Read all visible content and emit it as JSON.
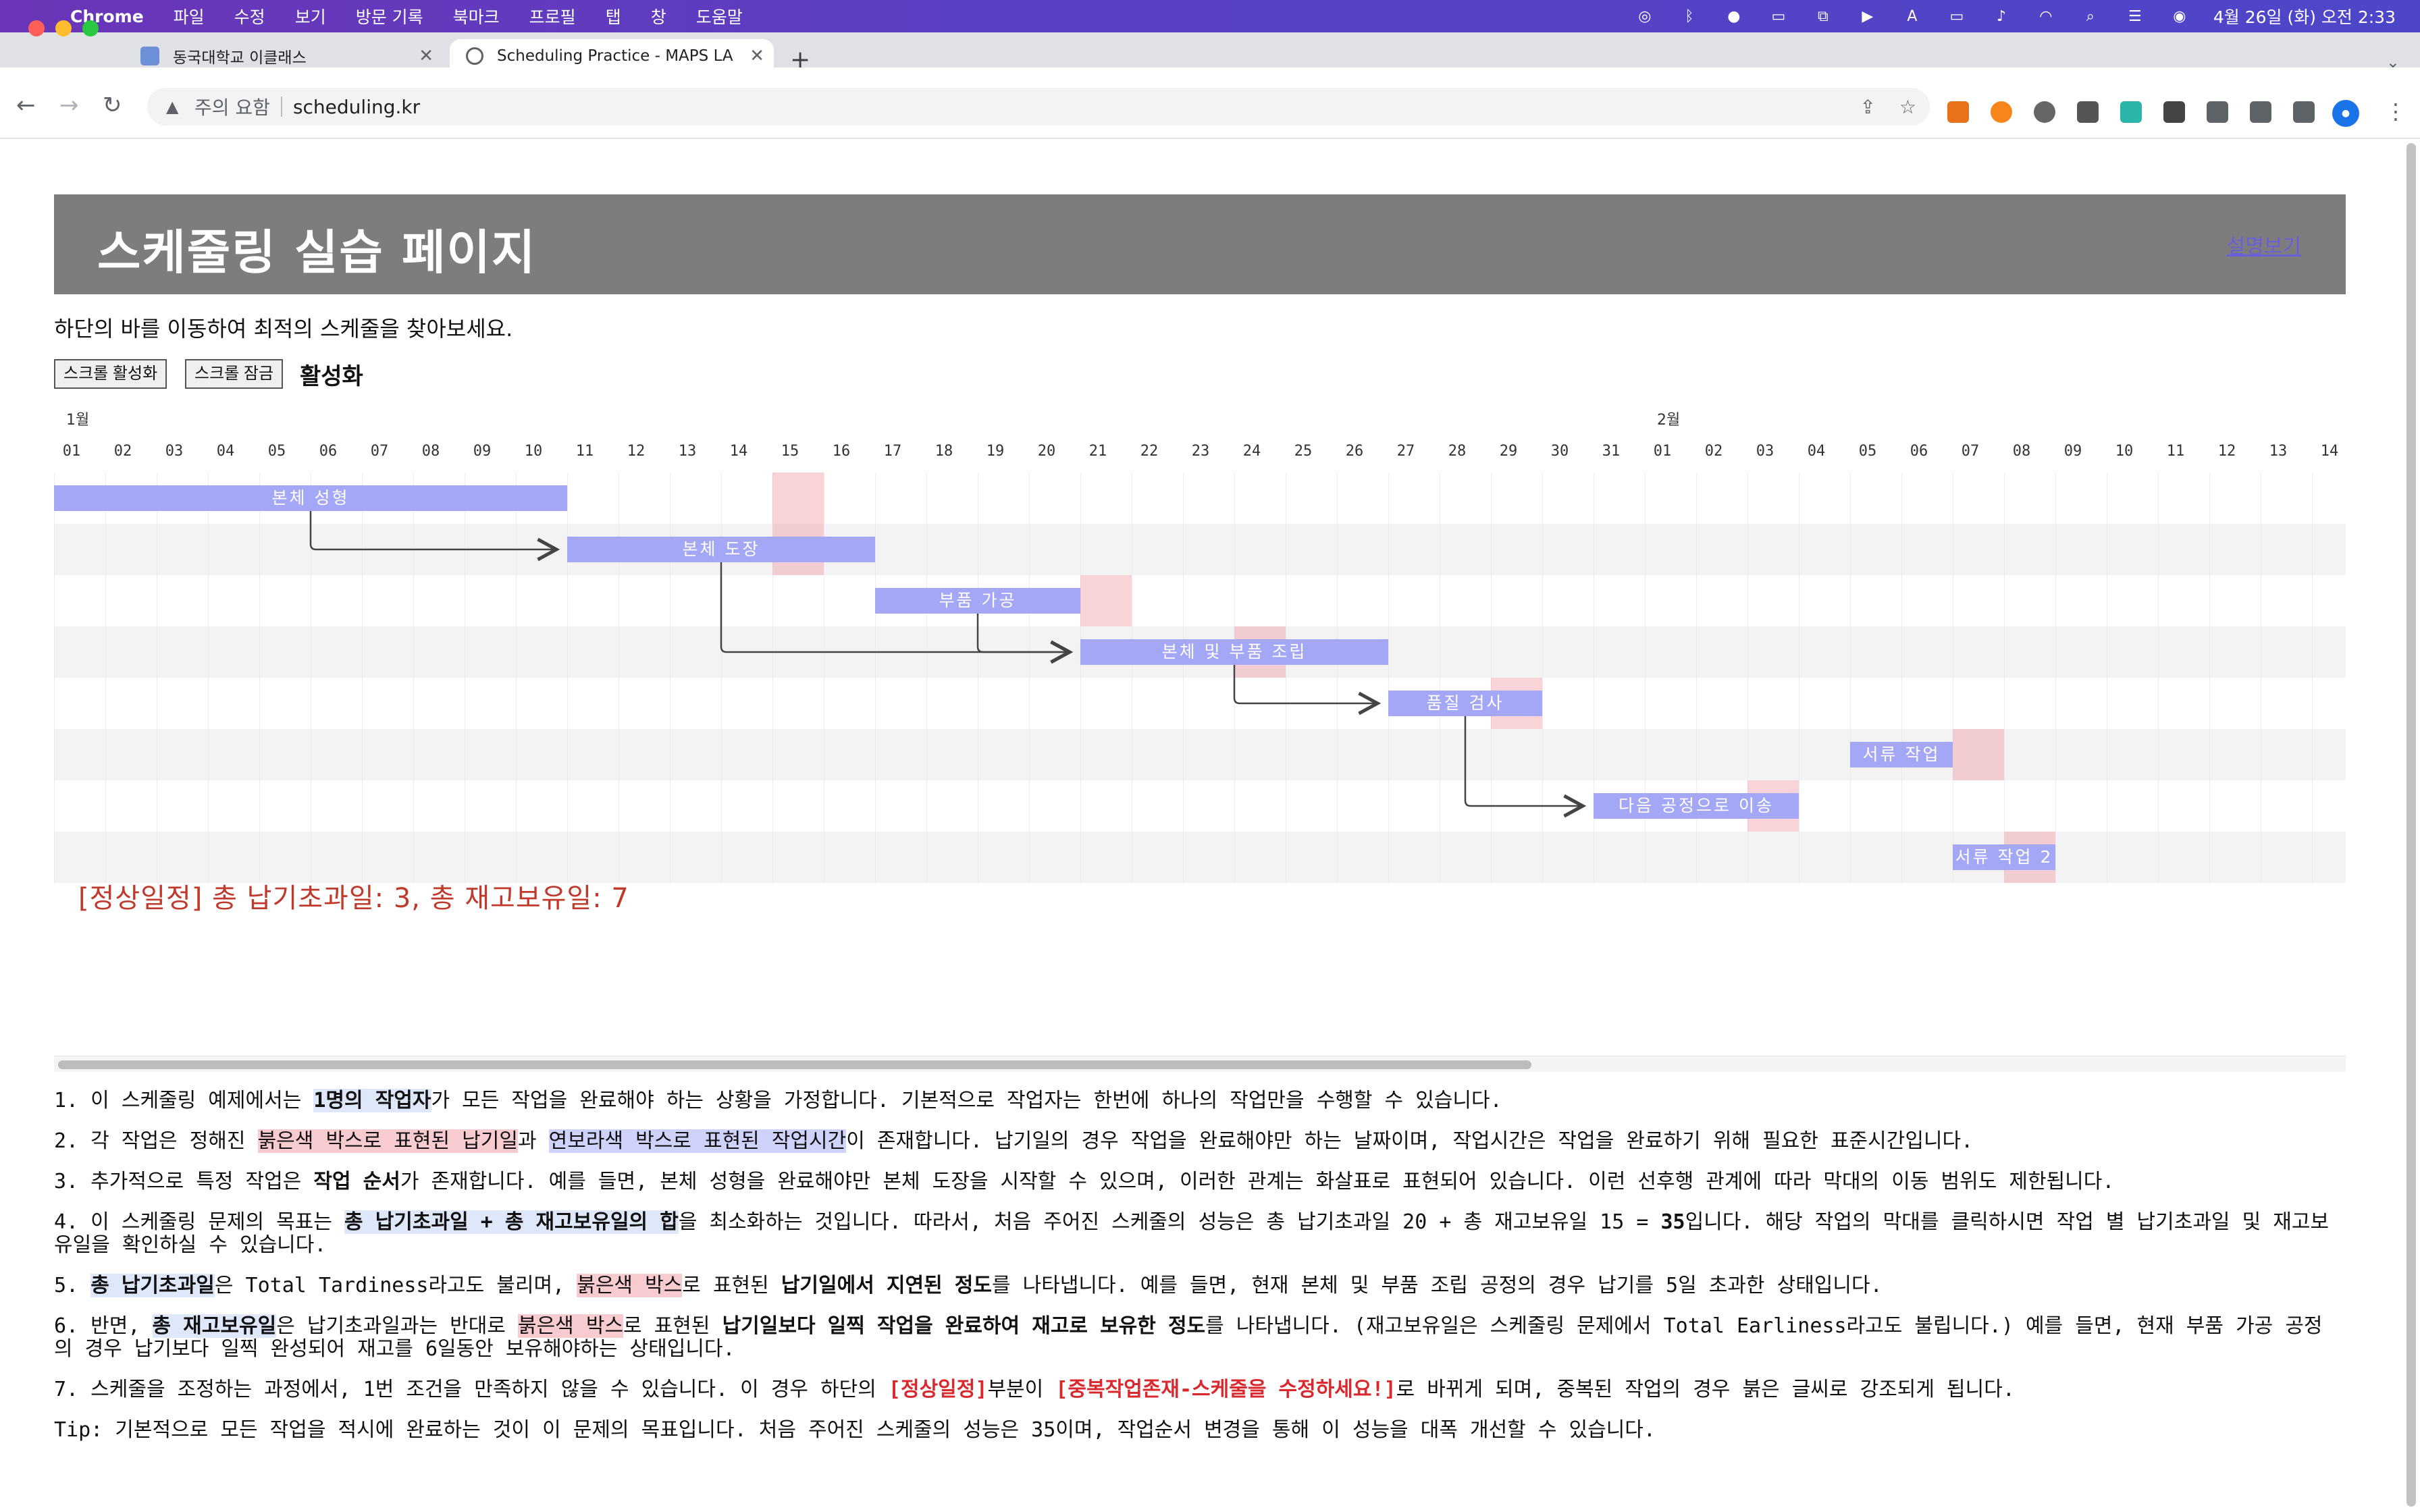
{
  "menubar": {
    "app": "Chrome",
    "items": [
      "파일",
      "수정",
      "보기",
      "방문 기록",
      "북마크",
      "프로필",
      "탭",
      "창",
      "도움말"
    ],
    "clock": "4월 26일 (화) 오전 2:33"
  },
  "tabs": [
    {
      "title": "동국대학교 이클래스"
    },
    {
      "title": "Scheduling Practice - MAPS LA"
    }
  ],
  "omnibox": {
    "warning": "주의 요함",
    "url": "scheduling.kr"
  },
  "page": {
    "title": "스케줄링 실습 페이지",
    "help_link": "설명보기",
    "subtitle": "하단의 바를 이동하여 최적의 스케줄을 찾아보세요.",
    "btn_scroll_on": "스크롤 활성화",
    "btn_scroll_lock": "스크롤 잠금",
    "status": "활성화",
    "summary": "[정상일정] 총 납기초과일: 3, 총 재고보유일: 7"
  },
  "gantt": {
    "months": [
      {
        "label": "1월",
        "col": 0
      },
      {
        "label": "2월",
        "col": 31
      }
    ],
    "days": [
      "01",
      "02",
      "03",
      "04",
      "05",
      "06",
      "07",
      "08",
      "09",
      "10",
      "11",
      "12",
      "13",
      "14",
      "15",
      "16",
      "17",
      "18",
      "19",
      "20",
      "21",
      "22",
      "23",
      "24",
      "25",
      "26",
      "27",
      "28",
      "29",
      "30",
      "31",
      "01",
      "02",
      "03",
      "04",
      "05",
      "06",
      "07",
      "08",
      "09",
      "10",
      "11",
      "12",
      "13",
      "14"
    ],
    "tasks": [
      {
        "name": "본체 성형",
        "start": 0,
        "dur": 10,
        "due": 14
      },
      {
        "name": "본체 도장",
        "start": 10,
        "dur": 6,
        "due": 14
      },
      {
        "name": "부품 가공",
        "start": 16,
        "dur": 4,
        "due": 20
      },
      {
        "name": "본체 및 부품 조립",
        "start": 20,
        "dur": 6,
        "due": 23
      },
      {
        "name": "품질 검사",
        "start": 26,
        "dur": 3,
        "due": 28
      },
      {
        "name": "서류 작업",
        "start": 35,
        "dur": 2,
        "due": 37
      },
      {
        "name": "다음 공정으로 이송",
        "start": 30,
        "dur": 4,
        "due": 33
      },
      {
        "name": "서류 작업 2",
        "start": 37,
        "dur": 2,
        "due": 38
      }
    ],
    "links": [
      [
        0,
        1
      ],
      [
        1,
        3
      ],
      [
        2,
        3
      ],
      [
        3,
        4
      ],
      [
        4,
        6
      ]
    ]
  },
  "notes": {
    "n1": [
      "1. 이 스케줄링 예제에서는 ",
      "1명의 작업자",
      "가 모든 작업을 완료해야 하는 상황을 가정합니다. 기본적으로 작업자는 한번에 하나의 작업만을 수행할 수 있습니다."
    ],
    "n2": [
      "2. 각 작업은 정해진 ",
      "붉은색 박스로 표현된 납기일",
      "과 ",
      "연보라색 박스로 표현된 작업시간",
      "이 존재합니다. 납기일의 경우 작업을 완료해야만 하는 날짜이며, 작업시간은 작업을 완료하기 위해 필요한 표준시간입니다."
    ],
    "n3": [
      "3. 추가적으로 특정 작업은 ",
      "작업 순서",
      "가 존재합니다. 예를 들면, 본체 성형을 완료해야만 본체 도장을 시작할 수 있으며, 이러한 관계는 화살표로 표현되어 있습니다. 이런 선후행 관계에 따라 막대의 이동 범위도 제한됩니다."
    ],
    "n4": [
      "4. 이 스케줄링 문제의 목표는 ",
      "총 납기초과일 + 총 재고보유일의 합",
      "을 최소화하는 것입니다. 따라서, 처음 주어진 스케줄의 성능은 총 납기초과일 20 + 총 재고보유일 15 = ",
      "35",
      "입니다. 해당 작업의 막대를 클릭하시면 작업 별 납기초과일 및 재고보유일을 확인하실 수 있습니다."
    ],
    "n5": [
      "5. ",
      "총 납기초과일",
      "은 Total Tardiness라고도 불리며, ",
      "붉은색 박스",
      "로 표현된 ",
      "납기일에서 지연된 정도",
      "를 나타냅니다. 예를 들면, 현재 본체 및 부품 조립 공정의 경우 납기를 5일 초과한 상태입니다."
    ],
    "n6": [
      "6. 반면, ",
      "총 재고보유일",
      "은 납기초과일과는 반대로 ",
      "붉은색 박스",
      "로 표현된 ",
      "납기일보다 일찍 작업을 완료하여 재고로 보유한 정도",
      "를 나타냅니다. (재고보유일은 스케줄링 문제에서 Total Earliness라고도 불립니다.) 예를 들면, 현재 부품 가공 공정의 경우 납기보다 일찍 완성되어 재고를 6일동안 보유해야하는 상태입니다."
    ],
    "n7": [
      "7. 스케줄을 조정하는 과정에서, 1번 조건을 만족하지 않을 수 있습니다. 이 경우 하단의 ",
      "[정상일정]",
      "부분이 ",
      "[중복작업존재-스케줄을 수정하세요!]",
      "로 바뀌게 되며, 중복된 작업의 경우 붉은 글씨로 강조되게 됩니다."
    ],
    "tip": "Tip: 기본적으로 모든 작업을 적시에 완료하는 것이 이 문제의 목표입니다. 처음 주어진 스케줄의 성능은 35이며, 작업순서 변경을 통해 이 성능을 대폭 개선할 수 있습니다."
  },
  "colors": {
    "bar": "#a3a7f5",
    "deadline": "#f0a0aa",
    "banner": "#7d7d7d",
    "summary": "#c0392b"
  }
}
